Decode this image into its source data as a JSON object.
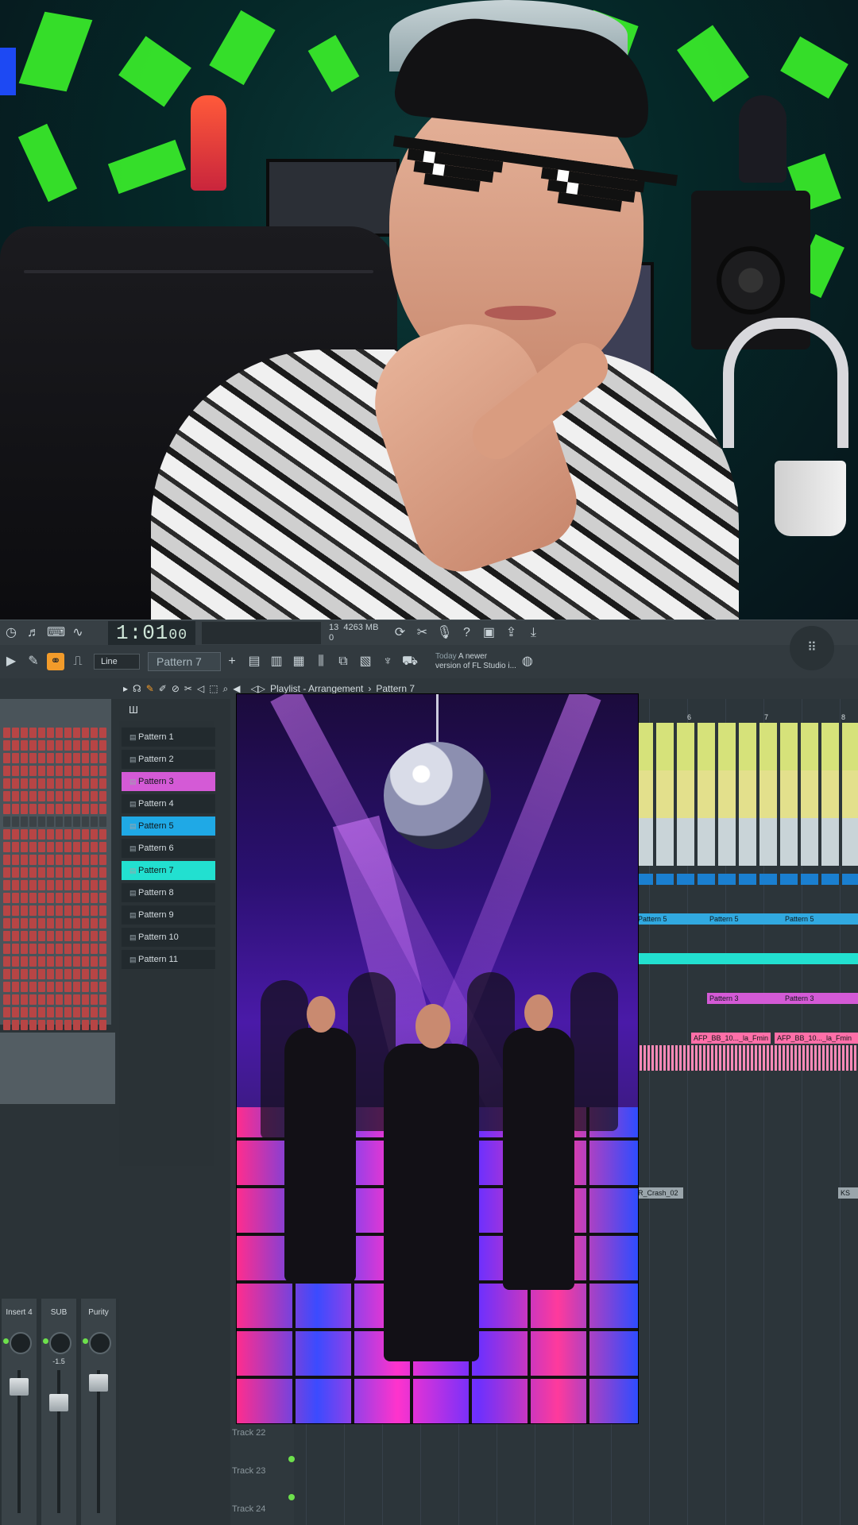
{
  "toolbar": {
    "time_main": "1:01",
    "time_small": "00",
    "cpu_top": "13",
    "memory": "4263 MB",
    "cpu_bottom": "0",
    "snap_mode": "Line",
    "pattern_select": "Pattern 7",
    "news_label": "Today",
    "news_text_line1": "A newer",
    "news_text_line2": "version of FL Studio i..."
  },
  "breadcrumb": {
    "root": "Playlist - Arrangement",
    "separator": "›",
    "current": "Pattern 7"
  },
  "patterns": [
    {
      "label": "Pattern 1",
      "color": "#222a2e"
    },
    {
      "label": "Pattern 2",
      "color": "#222a2e"
    },
    {
      "label": "Pattern 3",
      "color": "#d45ad6"
    },
    {
      "label": "Pattern 4",
      "color": "#222a2e"
    },
    {
      "label": "Pattern 5",
      "color": "#1fa9e6"
    },
    {
      "label": "Pattern 6",
      "color": "#222a2e"
    },
    {
      "label": "Pattern 7",
      "color": "#22e0d0"
    },
    {
      "label": "Pattern 8",
      "color": "#222a2e"
    },
    {
      "label": "Pattern 9",
      "color": "#222a2e"
    },
    {
      "label": "Pattern 10",
      "color": "#222a2e"
    },
    {
      "label": "Pattern 11",
      "color": "#222a2e"
    }
  ],
  "mixer": {
    "strips": [
      {
        "label": "Insert 4",
        "value": ""
      },
      {
        "label": "SUB",
        "value": "-1.5"
      },
      {
        "label": "Purity",
        "value": ""
      }
    ]
  },
  "playlist": {
    "clips": [
      {
        "label": "Pattern 5",
        "color": "#31a9e0"
      },
      {
        "label": "Pattern 5",
        "color": "#31a9e0"
      },
      {
        "label": "Pattern 5",
        "color": "#31a9e0"
      },
      {
        "label": "Pattern 3",
        "color": "#d45ad6"
      },
      {
        "label": "Pattern 3",
        "color": "#d45ad6"
      },
      {
        "label": "AFP_BB_10..._la_Fmin",
        "color": "#ff6fa8"
      },
      {
        "label": "AFP_BB_10..._la_Fmin",
        "color": "#ff6fa8"
      },
      {
        "label": "R_Crash_02",
        "color": "#9aa5ab"
      },
      {
        "label": "KS",
        "color": "#9aa5ab"
      }
    ],
    "tracks": [
      "Track 22",
      "Track 23",
      "Track 24"
    ],
    "bar_numbers": [
      "6",
      "7",
      "8"
    ]
  },
  "icons": {
    "menu": "grid-dots-icon"
  }
}
